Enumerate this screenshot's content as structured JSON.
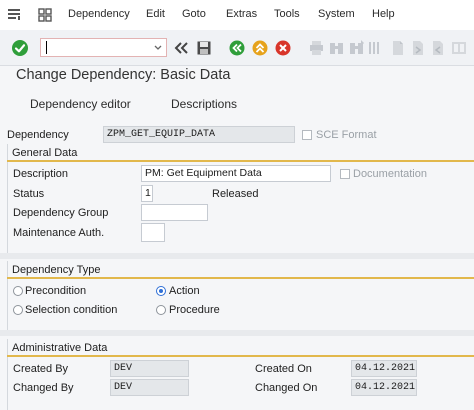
{
  "menu": {
    "items": [
      {
        "label": "Dependency"
      },
      {
        "label": "Edit"
      },
      {
        "label": "Goto"
      },
      {
        "label": "Extras"
      },
      {
        "label": "Tools"
      },
      {
        "label": "System"
      },
      {
        "label": "Help"
      }
    ]
  },
  "toolbar": {
    "command_field_value": "",
    "icons": [
      "enter-icon",
      "double-chevron-left-icon",
      "save-icon",
      "back-icon",
      "exit-icon",
      "cancel-icon",
      "print-icon",
      "find-icon",
      "find-next-icon",
      "first-page-icon",
      "prev-page-icon",
      "next-page-icon",
      "last-page-icon"
    ]
  },
  "title": "Change Dependency: Basic Data",
  "tabs": [
    {
      "label": "Dependency editor"
    },
    {
      "label": "Descriptions"
    }
  ],
  "dependency": {
    "label": "Dependency",
    "value": "ZPM_GET_EQUIP_DATA",
    "sce_format_label": "SCE Format",
    "sce_format_checked": false
  },
  "general_data": {
    "heading": "General Data",
    "description_label": "Description",
    "description_value": "PM: Get Equipment Data",
    "documentation_label": "Documentation",
    "documentation_checked": false,
    "status_label": "Status",
    "status_value": "1",
    "status_text": "Released",
    "dependency_group_label": "Dependency Group",
    "dependency_group_value": "",
    "maintenance_auth_label": "Maintenance Auth.",
    "maintenance_auth_value": ""
  },
  "dependency_type": {
    "heading": "Dependency Type",
    "options": [
      {
        "label": "Precondition",
        "selected": false
      },
      {
        "label": "Action",
        "selected": true
      },
      {
        "label": "Selection condition",
        "selected": false
      },
      {
        "label": "Procedure",
        "selected": false
      }
    ]
  },
  "administrative_data": {
    "heading": "Administrative Data",
    "created_by_label": "Created By",
    "created_by_value": "DEV",
    "changed_by_label": "Changed By",
    "changed_by_value": "DEV",
    "created_on_label": "Created On",
    "created_on_value": "04.12.2021",
    "changed_on_label": "Changed On",
    "changed_on_value": "04.12.2021"
  },
  "colors": {
    "accent_line": "#e2b84c",
    "enter_green": "#2f9e3a",
    "cancel_red": "#d8352a",
    "exit_orange": "#e6a21b"
  }
}
